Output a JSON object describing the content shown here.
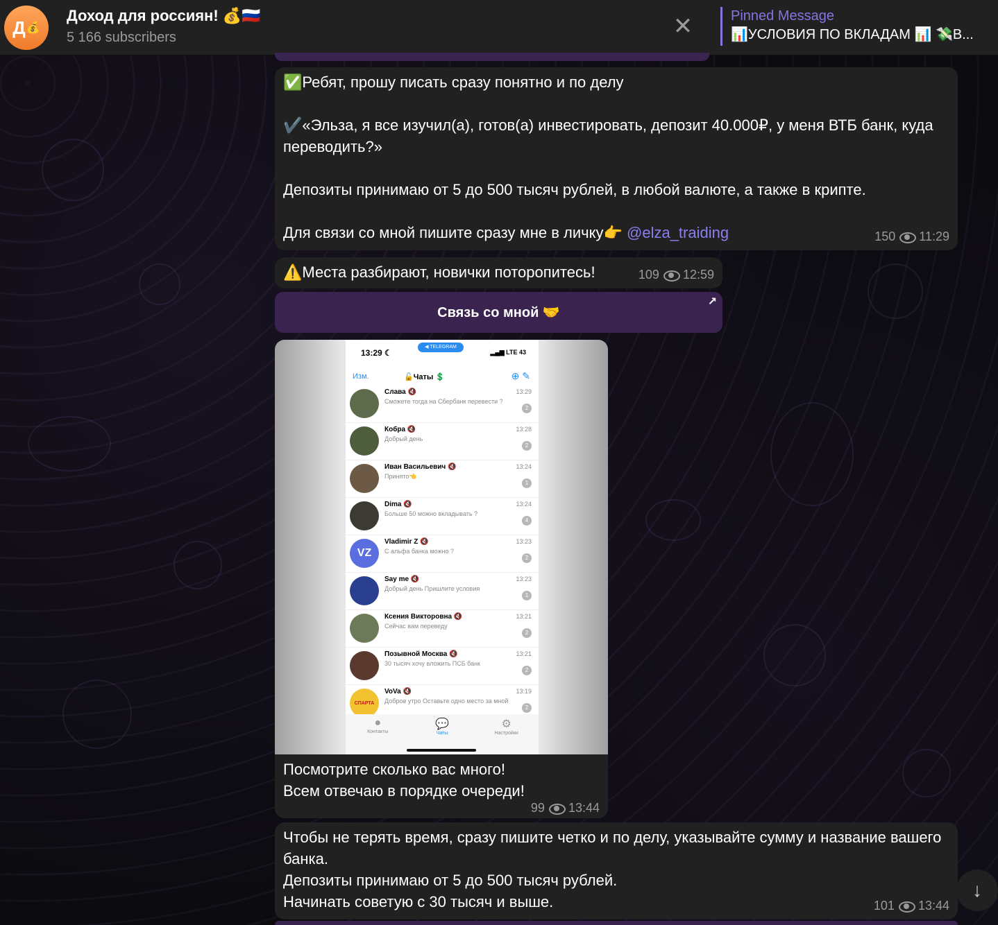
{
  "header": {
    "avatar_text": "Д",
    "avatar_emoji": "💰",
    "title": "Доход для россиян! 💰🇷🇺",
    "subscribers": "5 166 subscribers",
    "close_icon": "✕",
    "pinned": {
      "label": "Pinned Message",
      "text": "📊УСЛОВИЯ ПО ВКЛАДАМ 📊 💸В..."
    }
  },
  "messages": {
    "m1": {
      "text_a": "✅Ребят, прошу писать сразу понятно и по делу\n\n✔️«Эльза, я все изучил(а), готов(а) инвестировать, депозит 40.000₽, у меня ВТБ банк, куда переводить?»\n\nДепозиты принимаю от 5 до 500 тысяч рублей, в любой валюте, а также в крипте.\n\nДля связи со мной пишите сразу мне в личку👉 ",
      "link": "@elza_traiding",
      "views": "150",
      "time": "11:29"
    },
    "m2": {
      "text": "⚠️Места разбирают, новички поторопитесь!",
      "views": "109",
      "time": "12:59"
    },
    "button": {
      "label": "Связь со мной 🤝",
      "arrow": "↗"
    },
    "m3": {
      "caption": "Посмотрите сколько вас много!\nВсем отвечаю в порядке очереди!",
      "views": "99",
      "time": "13:44",
      "phone": {
        "time": "13:29 ☾",
        "pill": "◀ TELEGRAM",
        "signal": "▂▄▆ LTE 43",
        "edit": "Изм.",
        "chats_title": "🔓Чаты 💲",
        "icons": "⊕ ✎",
        "tabs": [
          {
            "icon": "●",
            "label": "Контакты"
          },
          {
            "icon": "💬",
            "label": "Чаты"
          },
          {
            "icon": "⚙",
            "label": "Настройки"
          }
        ],
        "chats": [
          {
            "name": "Слава 🔇",
            "text": "Сможете тогда на Сбербанк перевести ?",
            "time": "13:29",
            "badge": "2",
            "ava": ""
          },
          {
            "name": "Кобра 🔇",
            "text": "Добрый день",
            "time": "13:28",
            "badge": "2",
            "ava": ""
          },
          {
            "name": "Иван Васильевич 🔇",
            "text": "Принято👈",
            "time": "13:24",
            "badge": "1",
            "ava": ""
          },
          {
            "name": "Dima 🔇",
            "text": "Больше 50 можно вкладывать ?",
            "time": "13:24",
            "badge": "4",
            "ava": ""
          },
          {
            "name": "Vladimir Z 🔇",
            "text": "С альфа банка можно ?",
            "time": "13:23",
            "badge": "2",
            "ava": "VZ"
          },
          {
            "name": "Say me 🔇",
            "text": "Добрый день Пришлите условия",
            "time": "13:23",
            "badge": "1",
            "ava": ""
          },
          {
            "name": "Ксения Викторовна 🔇",
            "text": "Сейчас вам переведу",
            "time": "13:21",
            "badge": "2",
            "ava": ""
          },
          {
            "name": "Позывной Москва 🔇",
            "text": "30 тысяч хочу вложить ПСБ банк",
            "time": "13:21",
            "badge": "2",
            "ava": ""
          },
          {
            "name": "VoVa 🔇",
            "text": "Доброе утро Оставьте одно место за мной",
            "time": "13:19",
            "badge": "2",
            "ava": "СПАРТА"
          }
        ]
      }
    },
    "m4": {
      "text": "Чтобы не терять время, сразу пишите четко и по делу, указывайте сумму и название вашего банка.\nДепозиты принимаю от 5 до 500 тысяч рублей.\nНачинать советую с 30 тысяч и выше.",
      "views": "101",
      "time": "13:44"
    }
  },
  "scroll_down_icon": "↓",
  "colors": {
    "accent": "#8774e1",
    "bubble": "#212121",
    "button": "#3b2350",
    "link": "#8b7ff0"
  }
}
